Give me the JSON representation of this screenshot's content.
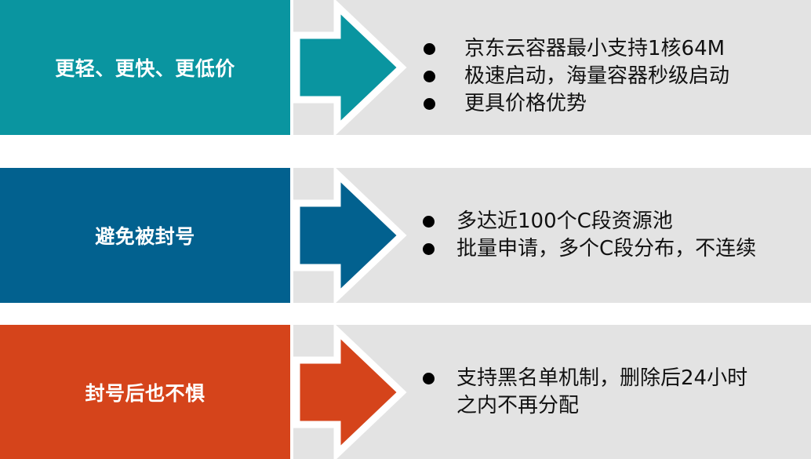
{
  "colors": {
    "row1": "#0a95a0",
    "row2": "#02618f",
    "row3": "#d5441b",
    "panel": "#e3e3e3",
    "arrow_outline": "#ffffff"
  },
  "rows": [
    {
      "label": "更轻、更快、更低价",
      "bullets": [
        "京东云容器最小支持1核64M",
        "极速启动，海量容器秒级启动",
        "更具价格优势"
      ]
    },
    {
      "label": "避免被封号",
      "bullets": [
        "多达近100个C段资源池",
        "批量申请，多个C段分布，不连续"
      ]
    },
    {
      "label": "封号后也不惧",
      "bullets": [
        "支持黑名单机制，删除后24小时",
        "之内不再分配"
      ]
    }
  ]
}
